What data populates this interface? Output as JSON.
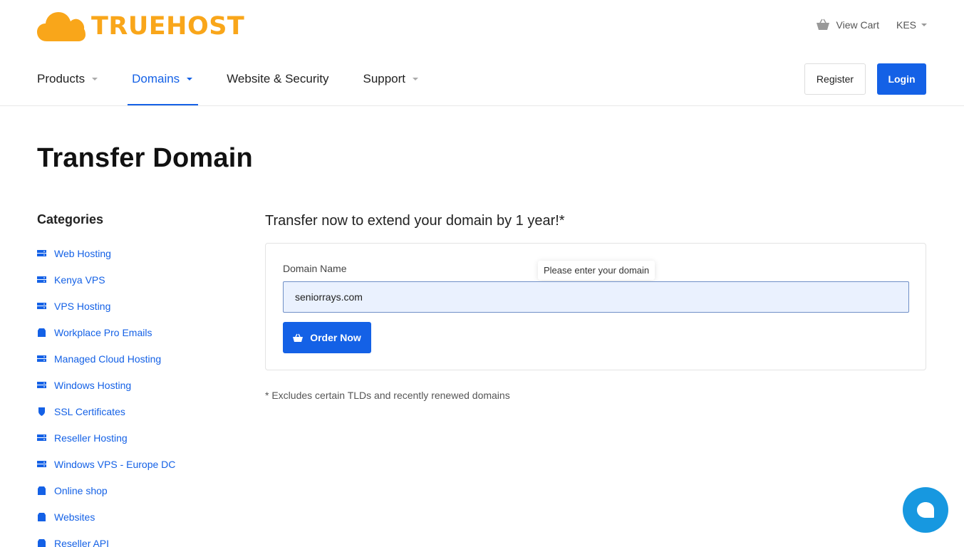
{
  "brand": {
    "name": "TRUEHOST",
    "color": "#f9a61a"
  },
  "topbar": {
    "cart_label": "View Cart",
    "currency": "KES"
  },
  "nav": {
    "items": [
      {
        "label": "Products",
        "has_dropdown": true,
        "active": false
      },
      {
        "label": "Domains",
        "has_dropdown": true,
        "active": true
      },
      {
        "label": "Website & Security",
        "has_dropdown": false,
        "active": false
      },
      {
        "label": "Support",
        "has_dropdown": true,
        "active": false
      }
    ]
  },
  "auth": {
    "register_label": "Register",
    "login_label": "Login"
  },
  "page": {
    "title": "Transfer Domain"
  },
  "sidebar": {
    "title": "Categories",
    "items": [
      {
        "label": "Web Hosting",
        "icon": "server-icon"
      },
      {
        "label": "Kenya VPS",
        "icon": "server-icon"
      },
      {
        "label": "VPS Hosting",
        "icon": "server-icon"
      },
      {
        "label": "Workplace Pro Emails",
        "icon": "box-icon"
      },
      {
        "label": "Managed Cloud Hosting",
        "icon": "server-icon"
      },
      {
        "label": "Windows Hosting",
        "icon": "server-icon"
      },
      {
        "label": "SSL Certificates",
        "icon": "shield-icon"
      },
      {
        "label": "Reseller Hosting",
        "icon": "server-icon"
      },
      {
        "label": "Windows VPS - Europe DC",
        "icon": "server-icon"
      },
      {
        "label": "Online shop",
        "icon": "box-icon"
      },
      {
        "label": "Websites",
        "icon": "box-icon"
      },
      {
        "label": "Reseller API",
        "icon": "box-icon"
      }
    ]
  },
  "transfer": {
    "heading": "Transfer now to extend your domain by 1 year!*",
    "field_label": "Domain Name",
    "tooltip": "Please enter your domain",
    "input_value": "seniorrays.com",
    "order_label": "Order Now",
    "footnote": "* Excludes certain TLDs and recently renewed domains"
  },
  "colors": {
    "primary": "#1461e6",
    "chat": "#1798e0"
  }
}
